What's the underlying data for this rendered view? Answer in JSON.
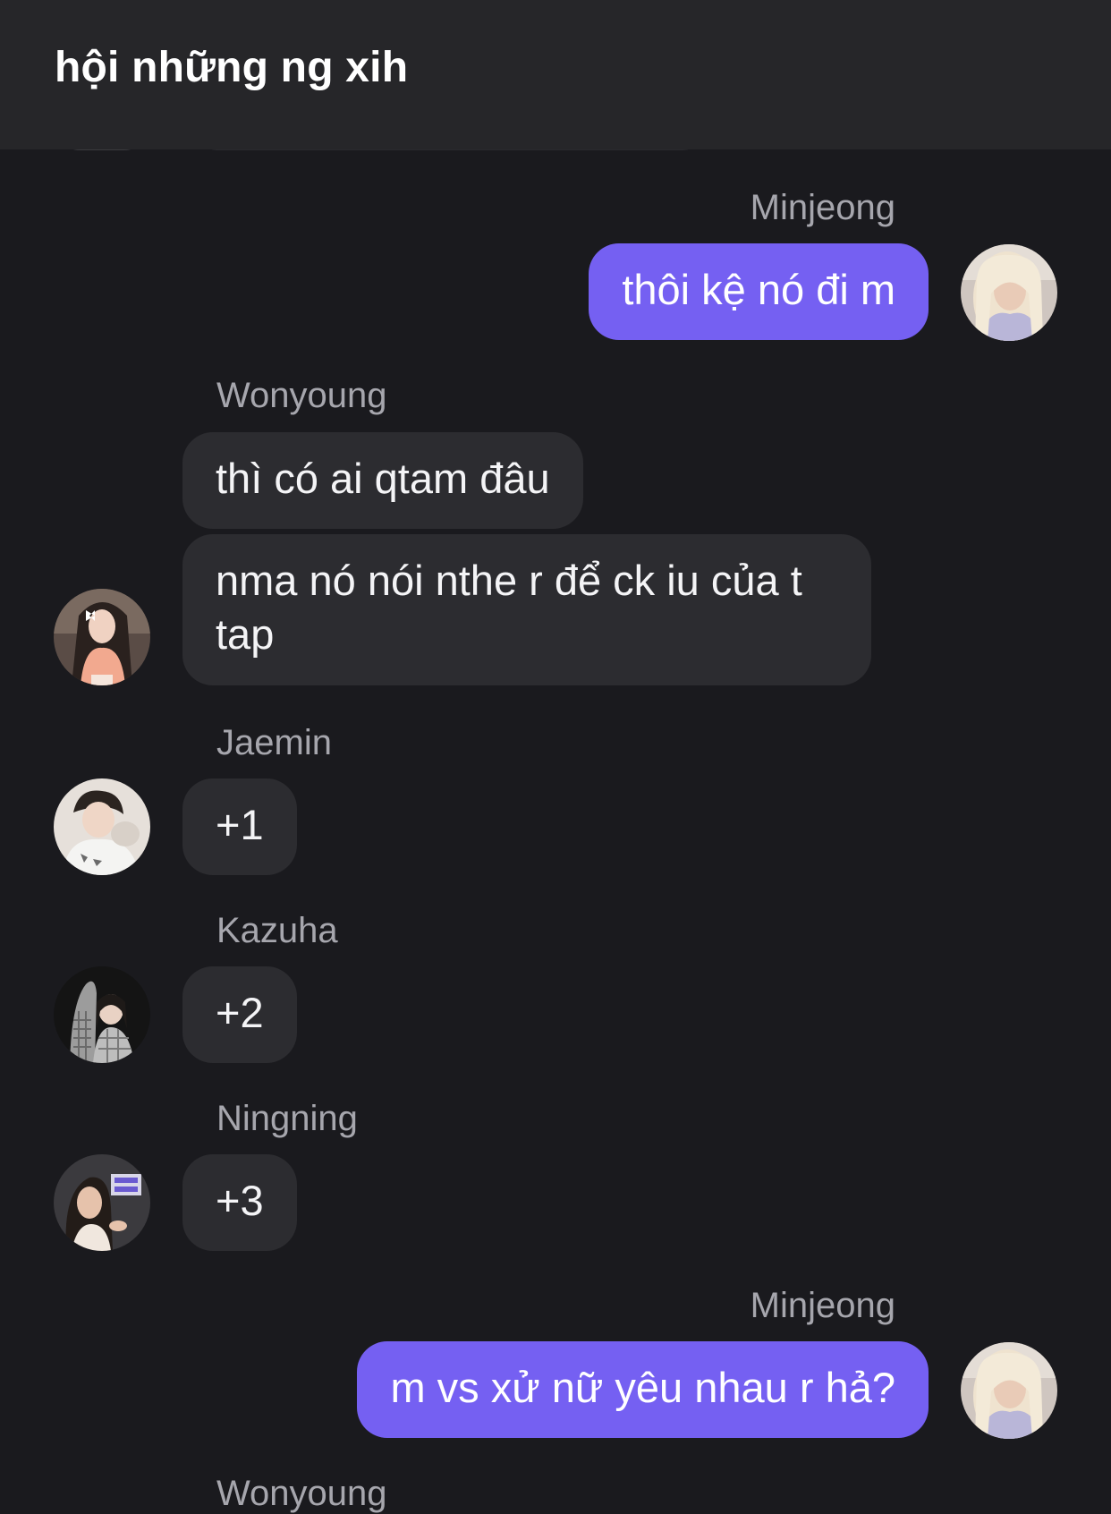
{
  "header": {
    "title": "hội những ng xih"
  },
  "messages": [
    {
      "sender": "Minjeong",
      "text": "thôi kệ nó đi m",
      "direction": "outgoing"
    },
    {
      "sender": "Wonyoung",
      "text": "thì có ai qtam đâu",
      "direction": "incoming"
    },
    {
      "sender": "Wonyoung",
      "text": "nma nó nói nthe r để ck iu của t tap",
      "direction": "incoming"
    },
    {
      "sender": "Jaemin",
      "text": "+1",
      "direction": "incoming"
    },
    {
      "sender": "Kazuha",
      "text": "+2",
      "direction": "incoming"
    },
    {
      "sender": "Ningning",
      "text": "+3",
      "direction": "incoming"
    },
    {
      "sender": "Minjeong",
      "text": "m vs xử nữ yêu nhau r hả?",
      "direction": "outgoing"
    },
    {
      "sender": "Wonyoung",
      "text": "",
      "direction": "incoming"
    }
  ],
  "colors": {
    "background": "#1a1a1e",
    "header": "#262629",
    "incoming_bubble": "#2c2c30",
    "outgoing_bubble": "#7560f2",
    "sender_name": "#a6a6ad"
  }
}
